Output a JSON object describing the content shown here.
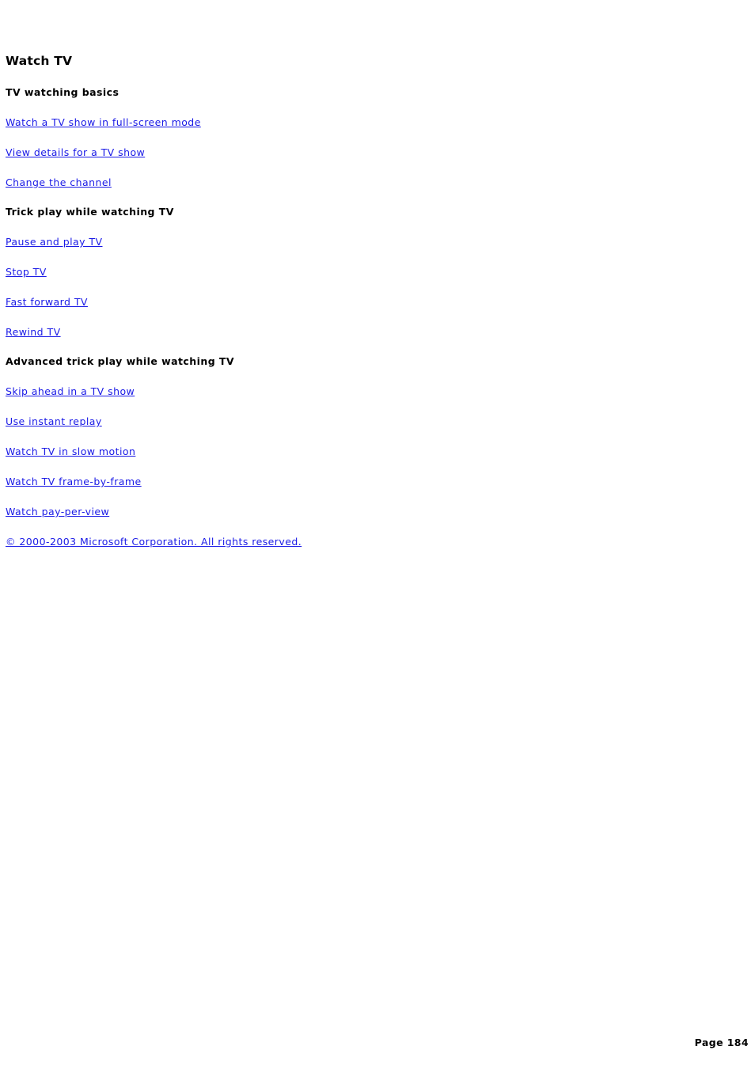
{
  "document": {
    "title": "Watch TV",
    "sections": [
      {
        "heading": "TV watching basics",
        "links": [
          "Watch a TV show in full-screen mode",
          "View details for a TV show",
          "Change the channel"
        ]
      },
      {
        "heading": "Trick play while watching TV",
        "links": [
          "Pause and play TV",
          "Stop TV",
          "Fast forward TV",
          "Rewind TV"
        ]
      },
      {
        "heading": "Advanced trick play while watching TV",
        "links": [
          "Skip ahead in a TV show",
          "Use instant replay",
          "Watch TV in slow motion",
          "Watch TV frame-by-frame",
          "Watch pay-per-view"
        ]
      }
    ],
    "copyright": "© 2000-2003 Microsoft Corporation. All rights reserved.",
    "footer": "Page 184",
    "colors": {
      "link": "#1a1ae6",
      "text": "#000000",
      "background": "#ffffff"
    }
  }
}
